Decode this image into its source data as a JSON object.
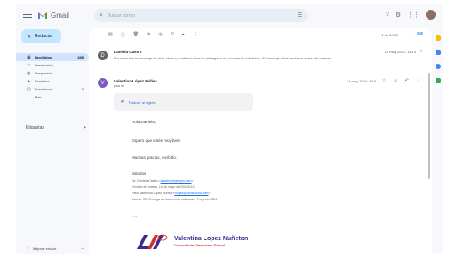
{
  "app": {
    "name": "Gmail"
  },
  "search": {
    "placeholder": "Buscar correo"
  },
  "compose": {
    "label": "Redactar"
  },
  "nav": {
    "items": [
      {
        "label": "Recibidos",
        "count": "285",
        "icon": "inbox-icon",
        "glyph": "▣",
        "active": true
      },
      {
        "label": "Destacados",
        "count": "",
        "icon": "star-icon",
        "glyph": "☆",
        "active": false
      },
      {
        "label": "Pospuestos",
        "count": "",
        "icon": "clock-icon",
        "glyph": "◷",
        "active": false
      },
      {
        "label": "Enviados",
        "count": "",
        "icon": "send-icon",
        "glyph": "➤",
        "active": false
      },
      {
        "label": "Borradores",
        "count": "5",
        "icon": "draft-icon",
        "glyph": "▢",
        "active": false
      },
      {
        "label": "Más",
        "count": "",
        "icon": "chevron-down-icon",
        "glyph": "⌄",
        "active": false
      }
    ],
    "labels_title": "Etiquetas",
    "labels_add": "+"
  },
  "meet": {
    "label": "Mejorar enlace"
  },
  "pager": {
    "range": "1 de 3.000"
  },
  "thread": {
    "message1": {
      "avatar": "D",
      "sender": "Daniela Castro",
      "snippet": "Por favor lee el mensaje de más abajo y confirma si se ha entregado el documento solicitado. El mensaje debe enviarse antes del viernes.",
      "date": "10 may 2024, 14:13"
    },
    "message2": {
      "avatar": "V",
      "sender": "Valentina López Núñez",
      "to": "para mí",
      "date": "14 may 2024, 9:15",
      "translate": "Traducir al inglés",
      "lines": [
        "Hola Daniela,",
        "Espero que estés muy bien.",
        "Muchas gracias, recibido.",
        "Saludos"
      ],
      "quoted": [
        {
          "prefix": "De: Daniela Castro <",
          "link": "dcastro@ejemplo.com",
          "suffix": ">"
        },
        {
          "prefix": "Enviado el: martes, 14 de mayo de 2024 9:10",
          "link": "",
          "suffix": ""
        },
        {
          "prefix": "Para: Valentina López Núñez <",
          "link": "vlopez@consultoria.com",
          "suffix": ">"
        },
        {
          "prefix": "Asunto: RE: Entrega de documento solicitado - Proyecto 2024",
          "link": "",
          "suffix": ""
        }
      ],
      "more": "..."
    }
  },
  "signature": {
    "name": "Valentina Lopez Nuñeton",
    "subtitle": "Consultoría Financiera Global"
  },
  "colors": {
    "accent": "#1a73e8",
    "compose_bg": "#c2e7ff",
    "active_nav": "#d3e3fd",
    "signature_name": "#3d2a8a",
    "signature_sub": "#d32f2f"
  }
}
